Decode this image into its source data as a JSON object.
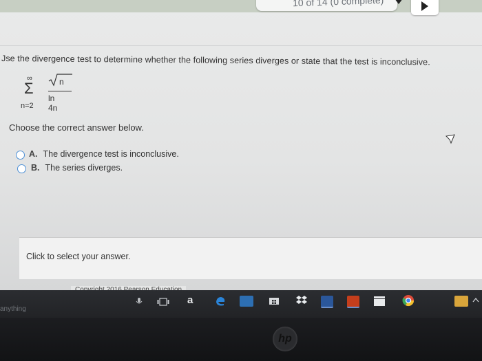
{
  "header": {
    "progress_text": "10 of 14 (0 complete)"
  },
  "question": {
    "prompt": "Jse the divergence test to determine whether the following series diverges or state that the test is inconclusive.",
    "series": {
      "upper_limit": "∞",
      "sigma": "Σ",
      "lower_limit": "n=2",
      "numerator_radicand": "n",
      "denominator": "ln 4n"
    }
  },
  "choices": {
    "instruction": "Choose the correct answer below.",
    "options": [
      {
        "letter": "A.",
        "text": "The divergence test is inconclusive."
      },
      {
        "letter": "B.",
        "text": "The series diverges."
      }
    ]
  },
  "answer_box": {
    "text": "Click to select your answer."
  },
  "footer": {
    "copyright": "Copyright 2016 Pearson Education"
  },
  "taskbar": {
    "search_hint": "anything",
    "amazon_letter": "a",
    "icons": [
      "mic-icon",
      "task-view-icon",
      "amazon-icon",
      "edge-icon",
      "file-explorer-icon",
      "store-icon",
      "dropbox-icon",
      "word-icon",
      "powerpoint-icon",
      "clapperboard-icon",
      "chrome-icon",
      "tray-chevron-icon"
    ]
  },
  "device": {
    "brand": "hp"
  }
}
